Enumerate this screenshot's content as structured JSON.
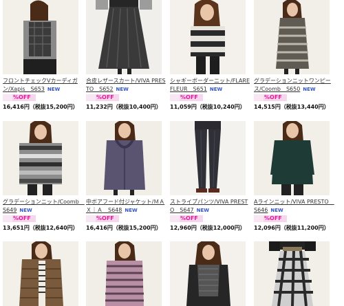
{
  "products": [
    {
      "title": "フロントチェックVカーディガン/Xapis　S653",
      "new": "NEW",
      "off": "%OFF",
      "price": "16,416円（税抜15,200円）"
    },
    {
      "title": "合皮レザースカート/VIVA PRESTO　S652",
      "new": "NEW",
      "off": "%OFF",
      "price": "11,232円（税抜10,400円）"
    },
    {
      "title": "シャギーボーダーニット/FLARE FLEUR　S651",
      "new": "NEW",
      "off": "%OFF",
      "price": "11,059円（税抜10,240円）"
    },
    {
      "title": "グラデーションニットワンピース/Coomb　S650",
      "new": "NEW",
      "off": "%OFF",
      "price": "14,515円（税抜13,440円）"
    },
    {
      "title": "グラデーションニット/Coomb　S649",
      "new": "NEW",
      "off": "%OFF",
      "price": "13,651円（税抜12,640円）"
    },
    {
      "title": "中ボアフード付ジャケット/ＭＡＸ｜Ａ　S648",
      "new": "NEW",
      "off": "%OFF",
      "price": "16,416円（税抜15,200円）"
    },
    {
      "title": "ストライプパンツ/VIVA PRESTO　S647",
      "new": "NEW",
      "off": "%OFF",
      "price": "12,960円（税抜12,000円）"
    },
    {
      "title": "Aラインニット/VIVA PRESTO　S646",
      "new": "NEW",
      "off": "%OFF",
      "price": "12,096円（税抜11,200円）"
    },
    {
      "title": "",
      "new": "",
      "off": "",
      "price": ""
    },
    {
      "title": "",
      "new": "",
      "off": "",
      "price": ""
    },
    {
      "title": "",
      "new": "",
      "off": "",
      "price": ""
    },
    {
      "title": "",
      "new": "",
      "off": "",
      "price": ""
    }
  ],
  "colors": {
    "link": "#333333",
    "new_badge": "#3355cc",
    "off_badge_bg": "#f6d6ee",
    "off_badge_text": "#e01b9a"
  },
  "icons": [
    "product-photo"
  ]
}
